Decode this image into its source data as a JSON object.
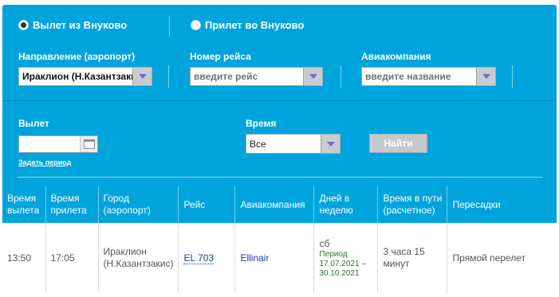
{
  "radios": {
    "departure": "Вылет из Внуково",
    "arrival": "Прилет во Внуково"
  },
  "filters": {
    "direction_label": "Направление (аэропорт)",
    "direction_value": "Ираклион (Н.Казантзакис)",
    "flight_label": "Номер рейса",
    "flight_placeholder": "введите рейс",
    "airline_label": "Авиакомпания",
    "airline_placeholder": "введите название"
  },
  "search": {
    "departure_label": "Вылет",
    "date_value": "",
    "period_link": "Задать период",
    "time_label": "Время",
    "time_value": "Все",
    "find_button": "Найти"
  },
  "table": {
    "headers": {
      "dep_time": "Время вылета",
      "arr_time": "Время прилета",
      "city": "Город (аэропорт)",
      "flight": "Рейс",
      "airline": "Авиакомпания",
      "days": "Дней в неделю",
      "duration": "Время в пути (расчетное)",
      "transfers": "Пересадки"
    },
    "rows": [
      {
        "dep_time": "13:50",
        "arr_time": "17:05",
        "city": "Ираклион (Н.Казантзакис)",
        "flight": "EL 703",
        "airline": "Ellinair",
        "days": "сб",
        "period_label": "Период",
        "period_value": "17.07.2021 – 30.10.2021",
        "duration": "3 часа 15 минут",
        "transfers": "Прямой перелет"
      }
    ]
  },
  "colors": {
    "panel": "#00a4dc",
    "link": "#1f3f8f",
    "period_text": "#2f6f2f"
  }
}
